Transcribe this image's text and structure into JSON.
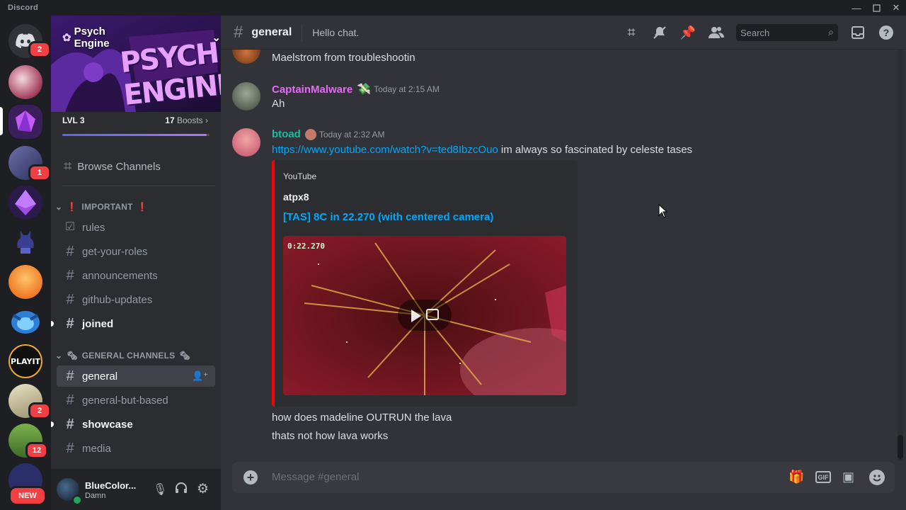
{
  "window": {
    "title": "Discord"
  },
  "rail": {
    "badges": {
      "home": "2",
      "server3": "1",
      "server10": "2",
      "server11": "12"
    },
    "playit_label": "PLAYIT",
    "new_label": "NEW"
  },
  "server": {
    "name": "Psych Engine",
    "banner_text": "PSYCH ENGINE",
    "level": "LVL 3",
    "boost_count": "17",
    "boost_label": "Boosts",
    "boost_progress": 0.98
  },
  "sidebar": {
    "browse": "Browse Channels",
    "categories": [
      {
        "name": "IMPORTANT",
        "emoji": "❗"
      },
      {
        "name": "GENERAL CHANNELS",
        "emoji": "🗞"
      }
    ],
    "channels": [
      {
        "name": "rules"
      },
      {
        "name": "get-your-roles"
      },
      {
        "name": "announcements"
      },
      {
        "name": "github-updates"
      },
      {
        "name": "joined"
      },
      {
        "name": "general"
      },
      {
        "name": "general-but-based"
      },
      {
        "name": "showcase"
      },
      {
        "name": "media"
      }
    ]
  },
  "user": {
    "name": "BlueColor...",
    "status": "Damn"
  },
  "header": {
    "channel": "general",
    "topic": "Hello chat.",
    "search_placeholder": "Search"
  },
  "messages": {
    "m0": {
      "text": "Maelstrom from troubleshootin"
    },
    "m1": {
      "author": "CaptainMalware",
      "author_color": "#e36cf5",
      "time": "Today at 2:15 AM",
      "text": "Ah"
    },
    "m2": {
      "author": "btoad",
      "author_color": "#1abc9c",
      "time": "Today at 2:32 AM",
      "link": "https://www.youtube.com/watch?v=ted8IbzcOuo",
      "text": " im always so fascinated by celeste tases",
      "embed": {
        "provider": "YouTube",
        "author": "atpx8",
        "title": "[TAS] 8C in 22.270 (with centered camera)",
        "video_timer": "0:22.270"
      },
      "followups": [
        "how does madeline OUTRUN the lava",
        "thats not how lava works"
      ]
    }
  },
  "composer": {
    "placeholder": "Message #general"
  }
}
